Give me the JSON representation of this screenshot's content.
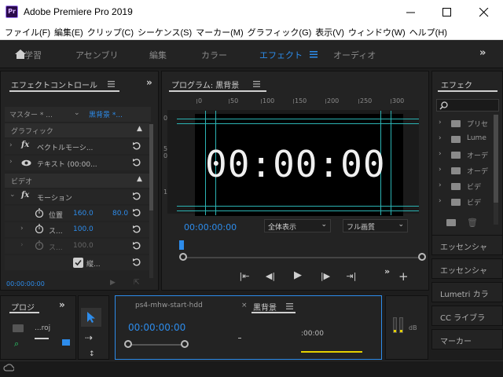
{
  "window": {
    "title": "Adobe Premiere Pro 2019",
    "app_icon_label": "Pr"
  },
  "menu": {
    "items": [
      "ファイル(F)",
      "編集(E)",
      "クリップ(C)",
      "シーケンス(S)",
      "マーカー(M)",
      "グラフィック(G)",
      "表示(V)",
      "ウィンドウ(W)",
      "ヘルプ(H)"
    ]
  },
  "workspaces": {
    "tabs": [
      "学習",
      "アセンブリ",
      "編集",
      "カラー",
      "エフェクト",
      "オーディオ"
    ],
    "active": "エフェクト",
    "more": "»"
  },
  "effect_controls": {
    "title": "エフェクトコントロール",
    "master_label": "マスター * ...",
    "clip_label": "黒背景 *...",
    "graphics_section": "グラフィック",
    "vector_motion": "ベクトルモーシ...",
    "text_item": "テキスト (00:00...",
    "video_section": "ビデオ",
    "motion": "モーション",
    "position_label": "位置",
    "position_x": "160.0",
    "position_y": "80.0",
    "scale_label": "ス...",
    "scale_value": "100.0",
    "scale2_label": "ス...",
    "scale2_value": "100.0",
    "checkbox_label": "縦...",
    "time": "00:00:00:00",
    "fx_icon": "fx"
  },
  "program_monitor": {
    "title": "プログラム: 黒背景",
    "ruler_labels": [
      "0",
      "50",
      "100",
      "150",
      "200",
      "250",
      "300"
    ],
    "left_ruler": [
      "0",
      "5",
      "0",
      "1"
    ],
    "timecode_display": "00:00:00",
    "current_time": "00:00:00:00",
    "zoom_option": "全体表示",
    "quality_option": "フル画質"
  },
  "effects_panel": {
    "title": "エフェク",
    "items": [
      "プリセ",
      "Lume",
      "オーデ",
      "オーデ",
      "ビデ",
      "ビデ"
    ],
    "more": "»"
  },
  "side_panels": [
    "エッセンシャ",
    "エッセンシャ",
    "Lumetri カラ",
    "CC ライブラ",
    "マーカー"
  ],
  "project": {
    "title": "プロジ",
    "item": "...roj"
  },
  "timeline": {
    "tab_inactive": "ps4-mhw-start-hdd",
    "tab_active": "黒背景",
    "current_time": "00:00:00:00",
    "ruler_time": ":00:00"
  },
  "audio_meter": {
    "label": "dB"
  }
}
